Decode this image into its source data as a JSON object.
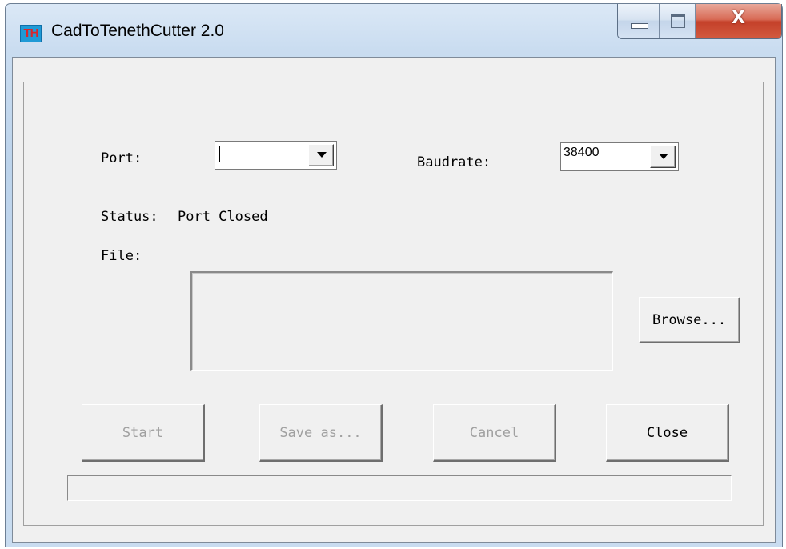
{
  "window": {
    "icon_text": "TH",
    "title": "CadToTenethCutter  2.0",
    "controls": {
      "minimize": "minimize-icon",
      "maximize": "maximize-icon",
      "close": "close-icon",
      "close_glyph": "X"
    }
  },
  "form": {
    "port_label": "Port:",
    "port_value": "",
    "baudrate_label": "Baudrate:",
    "baudrate_value": "38400",
    "status_label": "Status:",
    "status_value": "Port Closed",
    "file_label": "File:",
    "file_value": "",
    "browse_label": "Browse..."
  },
  "buttons": {
    "start": {
      "label": "Start",
      "enabled": false
    },
    "save_as": {
      "label": "Save as...",
      "enabled": false
    },
    "cancel": {
      "label": "Cancel",
      "enabled": false
    },
    "close": {
      "label": "Close",
      "enabled": true
    }
  },
  "progress": {
    "value": 0
  },
  "colors": {
    "titlebar": "#c9dcf0",
    "client": "#f0f0f0",
    "close_button": "#c4402a",
    "disabled_text": "#a0a0a0"
  }
}
